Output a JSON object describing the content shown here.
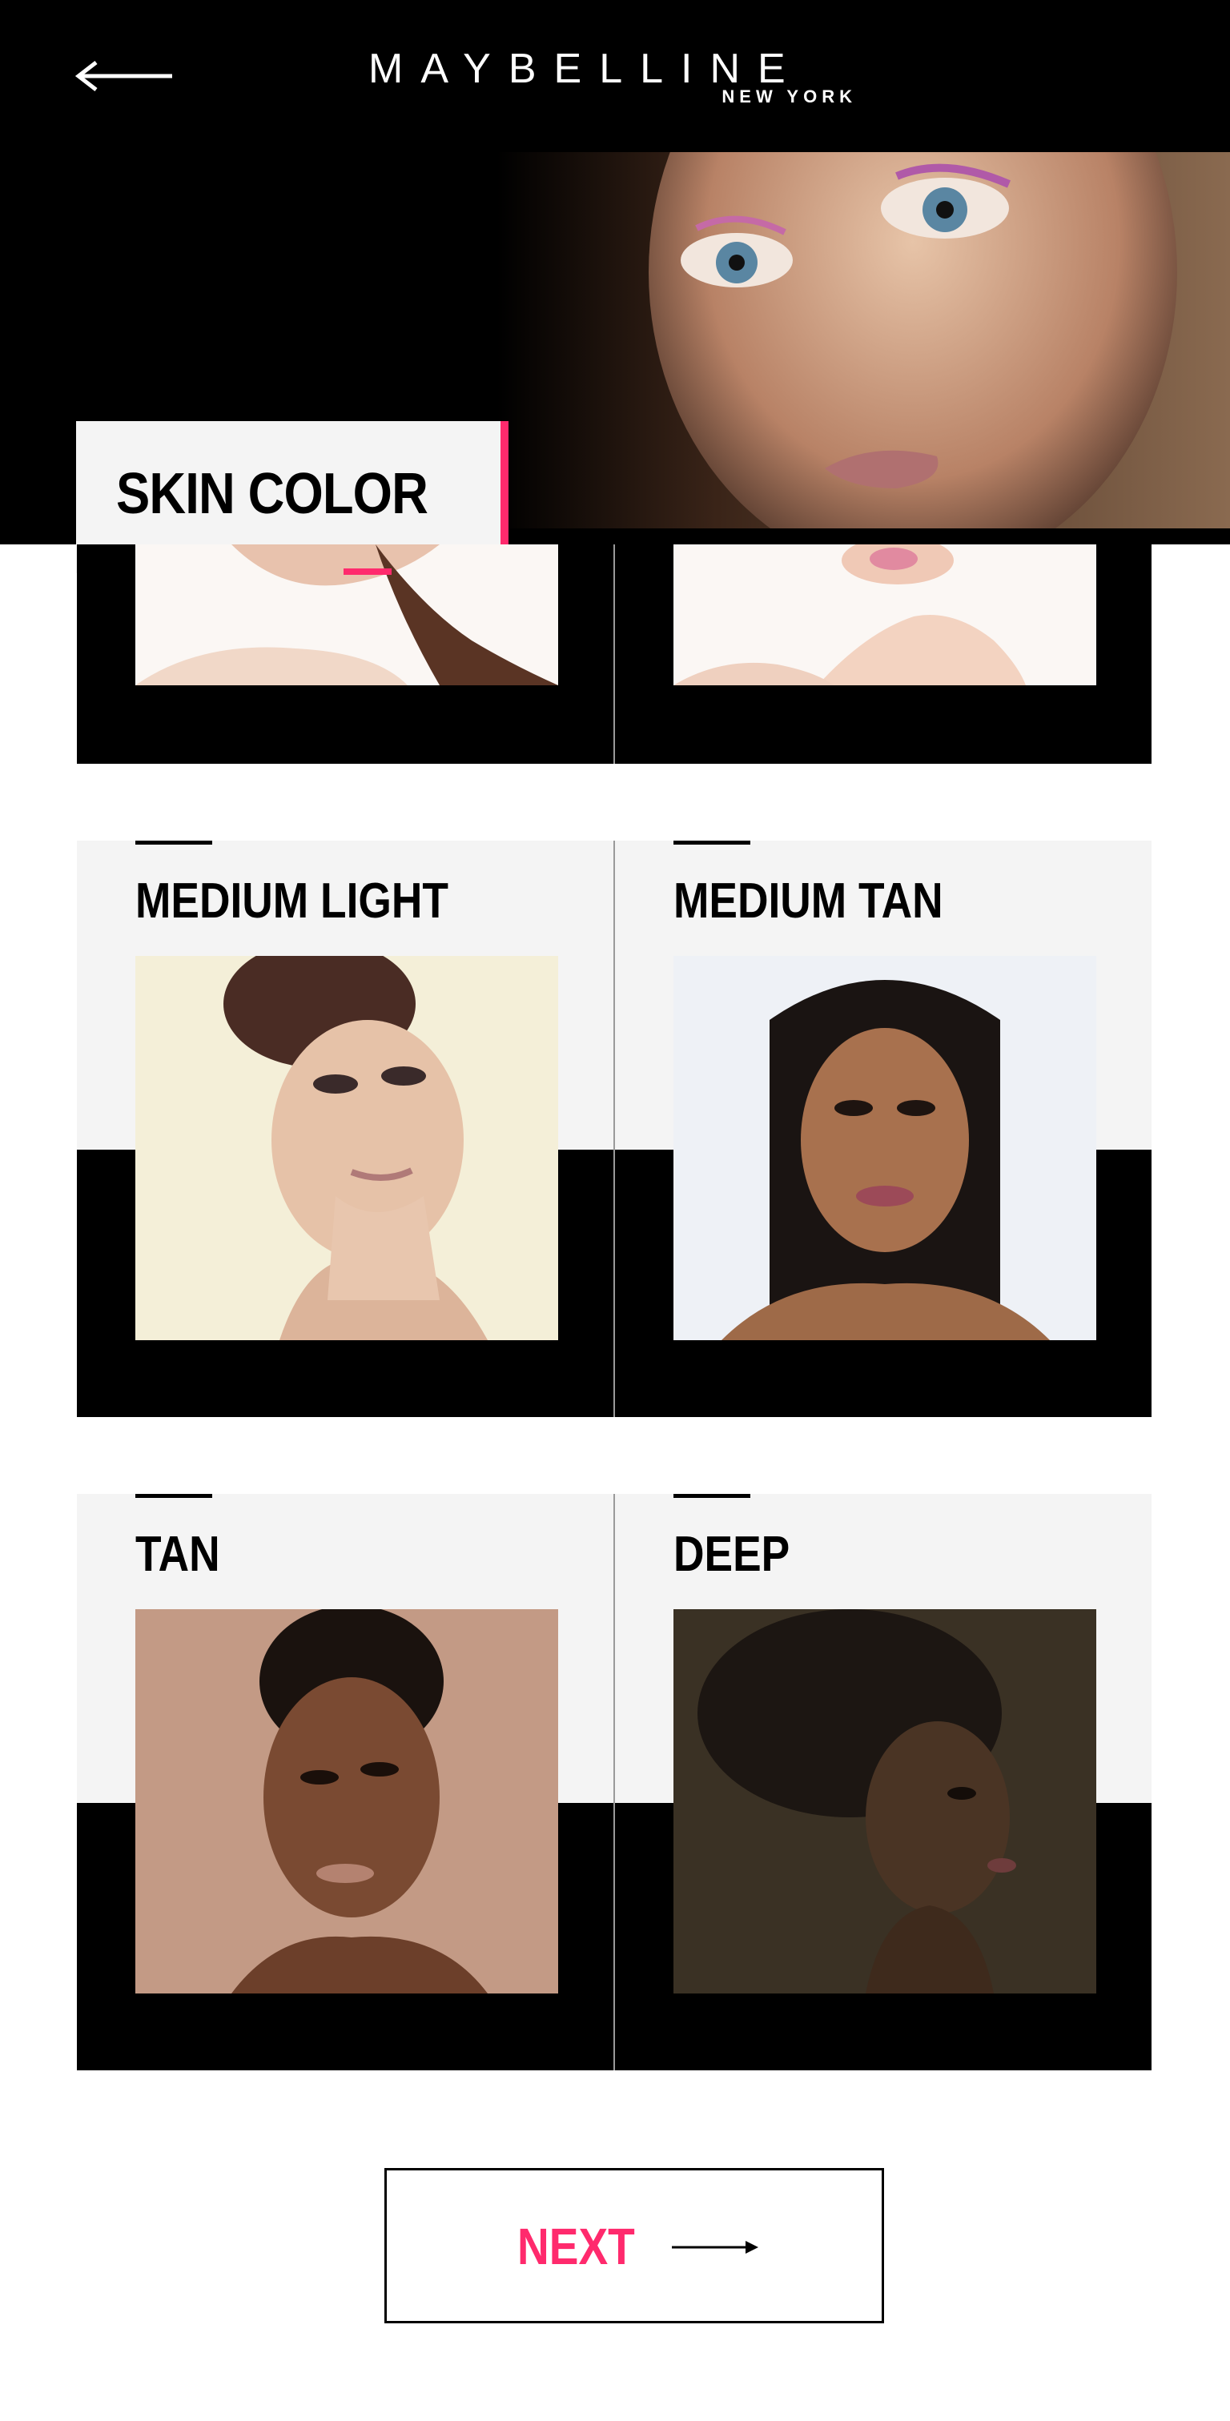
{
  "header": {
    "brand": "MAYBELLINE",
    "brand_sub": "NEW YORK",
    "back_icon": "arrow-left-icon"
  },
  "section": {
    "title": "SKIN COLOR"
  },
  "skin_tones": [
    {
      "label": ""
    },
    {
      "label": ""
    },
    {
      "label": "MEDIUM LIGHT"
    },
    {
      "label": "MEDIUM TAN"
    },
    {
      "label": "TAN"
    },
    {
      "label": "DEEP"
    }
  ],
  "footer": {
    "next_label": "NEXT",
    "next_icon": "arrow-right-icon"
  },
  "colors": {
    "accent": "#ff2a6d",
    "black": "#000000",
    "card_bg": "#f4f4f4"
  }
}
